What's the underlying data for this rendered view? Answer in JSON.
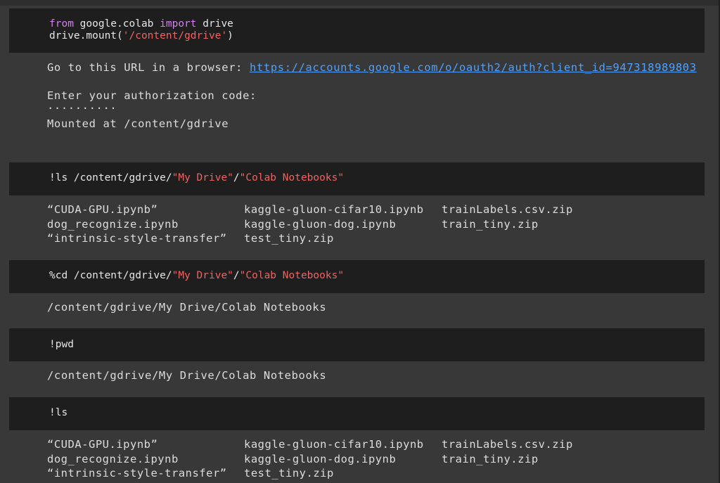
{
  "cells": [
    {
      "input": {
        "line1": {
          "kw1": "from",
          "mid": " google.colab ",
          "kw2": "import",
          "tail": " drive"
        },
        "line2": {
          "head": "drive.mount(",
          "str": "'/content/gdrive'",
          "tail": ")"
        }
      },
      "output": {
        "url_prefix": "Go to this URL in a browser: ",
        "url": "https://accounts.google.com/o/oauth2/auth?client_id=947318989803",
        "auth_prompt": "Enter your authorization code:",
        "auth_masked": "··········",
        "mounted": "Mounted at /content/gdrive"
      }
    },
    {
      "input": {
        "head": "!ls /content/gdrive/",
        "str1": "\"My Drive\"",
        "sep": "/",
        "str2": "\"Colab Notebooks\""
      },
      "output": {
        "col1": [
          "“CUDA-GPU.ipynb”",
          "dog_recognize.ipynb",
          "“intrinsic-style-transfer”"
        ],
        "col2": [
          "kaggle-gluon-cifar10.ipynb",
          "kaggle-gluon-dog.ipynb",
          "test_tiny.zip"
        ],
        "col3": [
          "trainLabels.csv.zip",
          "train_tiny.zip"
        ]
      }
    },
    {
      "input": {
        "head": "%cd /content/gdrive/",
        "str1": "\"My Drive\"",
        "sep": "/",
        "str2": "\"Colab Notebooks\""
      },
      "output": {
        "text": "/content/gdrive/My Drive/Colab Notebooks"
      }
    },
    {
      "input": {
        "code": "!pwd"
      },
      "output": {
        "text": "/content/gdrive/My Drive/Colab Notebooks"
      }
    },
    {
      "input": {
        "code": "!ls"
      },
      "output": {
        "col1": [
          "“CUDA-GPU.ipynb”",
          "dog_recognize.ipynb",
          "“intrinsic-style-transfer”"
        ],
        "col2": [
          "kaggle-gluon-cifar10.ipynb",
          "kaggle-gluon-dog.ipynb",
          "test_tiny.zip"
        ],
        "col3": [
          "trainLabels.csv.zip",
          "train_tiny.zip"
        ]
      }
    }
  ],
  "colors": {
    "background": "#383838",
    "cell_input": "#1e1e1e",
    "keyword": "#d47ef0",
    "string": "#f06262",
    "link": "#4ea1ff"
  }
}
